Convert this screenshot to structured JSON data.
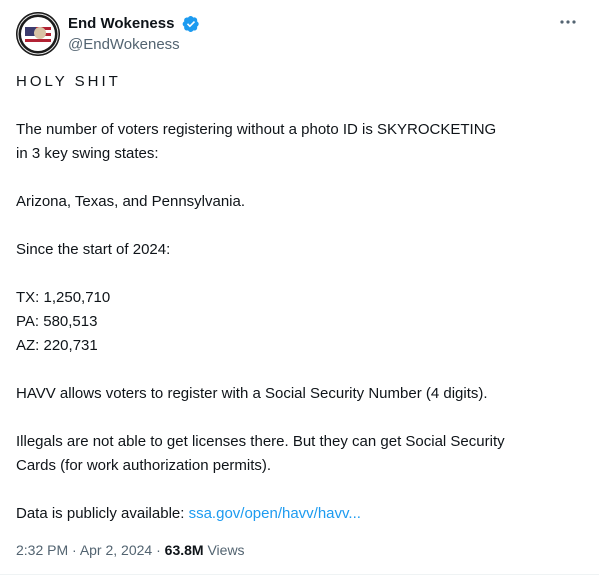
{
  "author": {
    "display_name": "End Wokeness",
    "handle": "@EndWokeness",
    "verified_color": "#1d9bf0",
    "avatar_text": "END WOKENESS"
  },
  "tweet": {
    "line1": "HOLY SHIT",
    "line2": "The number of voters registering without a photo ID is SKYROCKETING",
    "line3": "in 3 key swing states:",
    "line4": "Arizona, Texas, and Pennsylvania.",
    "line5": "Since the start of 2024:",
    "line6": "TX: 1,250,710",
    "line7": "PA: 580,513",
    "line8": "AZ: 220,731",
    "line9": "HAVV allows voters to register with a Social Security Number (4 digits).",
    "line10": "Illegals are not able to get licenses there. But they can get Social Security",
    "line11": "Cards (for work authorization permits).",
    "line12_prefix": "Data is publicly available: ",
    "link_text": "ssa.gov/open/havv/havv..."
  },
  "meta": {
    "time": "2:32 PM",
    "separator": " · ",
    "date": "Apr 2, 2024",
    "views_count": "63.8M",
    "views_label": " Views"
  },
  "colors": {
    "link": "#1d9bf0",
    "secondary_text": "#536471",
    "primary_text": "#0f1419"
  }
}
